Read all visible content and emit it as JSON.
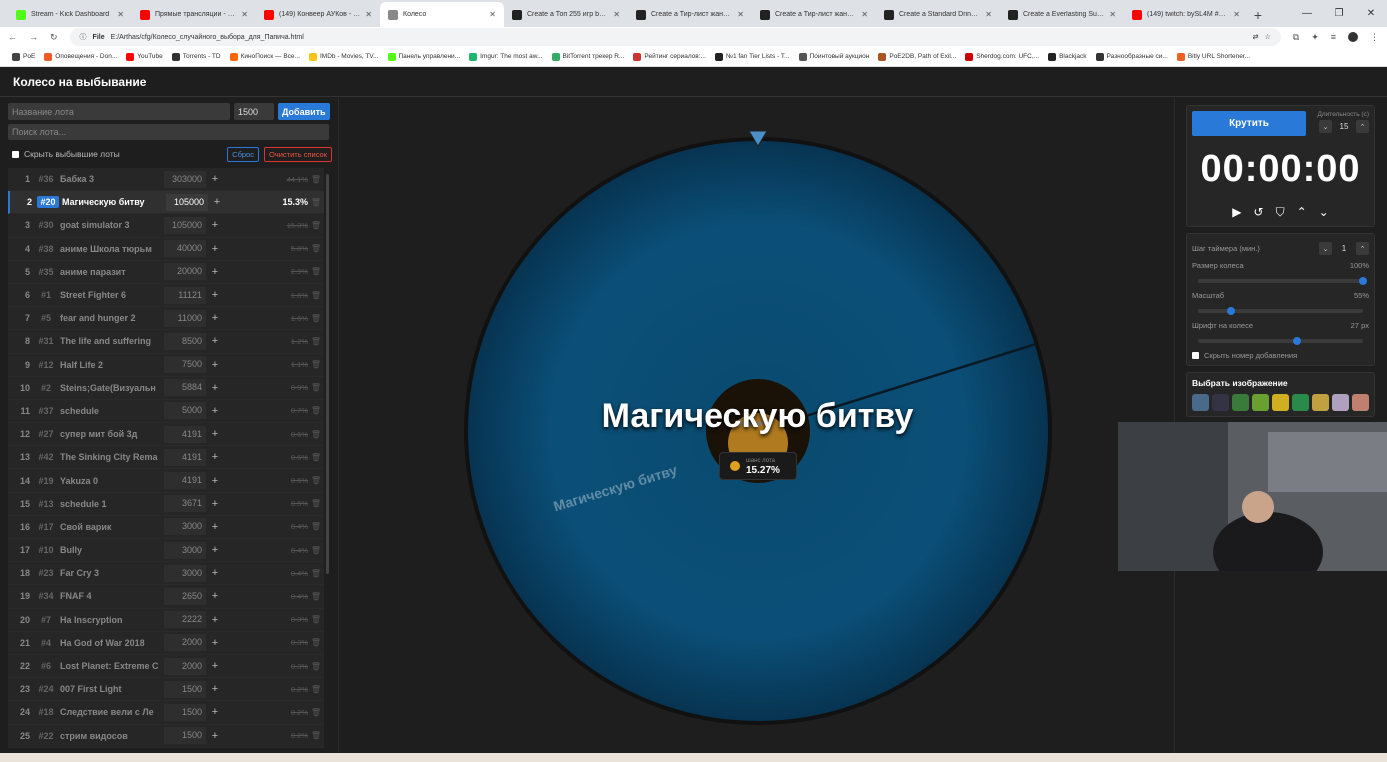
{
  "browser": {
    "tabs": [
      {
        "title": "Stream - Kick Dashboard",
        "color": "#53fc18",
        "active": false
      },
      {
        "title": "Прямые трансляции - YouTube",
        "color": "#ff0000",
        "active": false
      },
      {
        "title": "(149) Конвеер АУКов - YouTube",
        "color": "#ff0000",
        "active": false
      },
      {
        "title": "Колесо",
        "color": "#888888",
        "active": true
      },
      {
        "title": "Create a Топ 255 игр by Arthas",
        "color": "#222222",
        "active": false
      },
      {
        "title": "Create a Тир-лист жанров и игр",
        "color": "#222222",
        "active": false
      },
      {
        "title": "Create a Тир-лист жанров и игр",
        "color": "#222222",
        "active": false
      },
      {
        "title": "Create a Standard Drink Tier List",
        "color": "#222222",
        "active": false
      },
      {
        "title": "Create a Everlasting Summer",
        "color": "#222222",
        "active": false
      },
      {
        "title": "(149) twitch: bySL4M #sl4m",
        "color": "#ff0000",
        "active": false
      }
    ],
    "address_prefix": "File",
    "address": "E:/Arthas/cfg/Колесо_случайного_выбора_для_Папича.html",
    "bookmarks": [
      {
        "label": "PoE",
        "color": "#444"
      },
      {
        "label": "Оповещения - Don...",
        "color": "#f05a28"
      },
      {
        "label": "YouTube",
        "color": "#ff0000"
      },
      {
        "label": "Torrents - TD",
        "color": "#333"
      },
      {
        "label": "КиноПоиск — Все...",
        "color": "#f60"
      },
      {
        "label": "IMDb - Movies, TV...",
        "color": "#f5c518"
      },
      {
        "label": "Панель управлени...",
        "color": "#53fc18"
      },
      {
        "label": "Imgur: The most aw...",
        "color": "#1bb76e"
      },
      {
        "label": "BitTorrent трекер R...",
        "color": "#3a6"
      },
      {
        "label": "Рейтинг сериалов:...",
        "color": "#c33"
      },
      {
        "label": "№1 fan Tier Lists - T...",
        "color": "#222"
      },
      {
        "label": "Поинтовый аукцион",
        "color": "#555"
      },
      {
        "label": "PoE2DB, Path of Exil...",
        "color": "#a52"
      },
      {
        "label": "Sherdog.com: UFC,...",
        "color": "#c00"
      },
      {
        "label": "Blackjack",
        "color": "#222"
      },
      {
        "label": "Разнообразные си...",
        "color": "#333"
      },
      {
        "label": "Bitly URL Shortener...",
        "color": "#ee6123"
      }
    ]
  },
  "app": {
    "title": "Колесо на выбывание",
    "lot_name_placeholder": "Название лота",
    "amount_value": "1500",
    "add_label": "Добавить",
    "search_placeholder": "Поиск лота...",
    "hide_eliminated_label": "Скрыть выбывшие лоты",
    "reset_label": "Сброс",
    "clear_label": "Очистить список"
  },
  "lots": [
    {
      "n": "1",
      "id": "#36",
      "name": "Бабка 3",
      "amount": "303000",
      "pct": "44.1%",
      "selected": false
    },
    {
      "n": "2",
      "id": "#20",
      "name": "Магическую битву",
      "amount": "105000",
      "pct": "15.3%",
      "selected": true
    },
    {
      "n": "3",
      "id": "#30",
      "name": "goat simulator 3",
      "amount": "105000",
      "pct": "15.3%",
      "selected": false
    },
    {
      "n": "4",
      "id": "#38",
      "name": "аниме Школа тюрьм",
      "amount": "40000",
      "pct": "5.8%",
      "selected": false
    },
    {
      "n": "5",
      "id": "#35",
      "name": "аниме паразит",
      "amount": "20000",
      "pct": "2.9%",
      "selected": false
    },
    {
      "n": "6",
      "id": "#1",
      "name": "Street Fighter 6",
      "amount": "11121",
      "pct": "1.6%",
      "selected": false
    },
    {
      "n": "7",
      "id": "#5",
      "name": "fear and hunger 2",
      "amount": "11000",
      "pct": "1.6%",
      "selected": false
    },
    {
      "n": "8",
      "id": "#31",
      "name": "The life and suffering",
      "amount": "8500",
      "pct": "1.2%",
      "selected": false
    },
    {
      "n": "9",
      "id": "#12",
      "name": "Half Life 2",
      "amount": "7500",
      "pct": "1.1%",
      "selected": false
    },
    {
      "n": "10",
      "id": "#2",
      "name": "Steins;Gate(Визуальн",
      "amount": "5884",
      "pct": "0.9%",
      "selected": false
    },
    {
      "n": "11",
      "id": "#37",
      "name": "schedule",
      "amount": "5000",
      "pct": "0.7%",
      "selected": false
    },
    {
      "n": "12",
      "id": "#27",
      "name": "супер мит бой 3д",
      "amount": "4191",
      "pct": "0.6%",
      "selected": false
    },
    {
      "n": "13",
      "id": "#42",
      "name": "The Sinking City Rema",
      "amount": "4191",
      "pct": "0.6%",
      "selected": false
    },
    {
      "n": "14",
      "id": "#19",
      "name": "Yakuza 0",
      "amount": "4191",
      "pct": "0.6%",
      "selected": false
    },
    {
      "n": "15",
      "id": "#13",
      "name": "schedule 1",
      "amount": "3671",
      "pct": "0.5%",
      "selected": false
    },
    {
      "n": "16",
      "id": "#17",
      "name": "Свой варик",
      "amount": "3000",
      "pct": "0.4%",
      "selected": false
    },
    {
      "n": "17",
      "id": "#10",
      "name": "Bully",
      "amount": "3000",
      "pct": "0.4%",
      "selected": false
    },
    {
      "n": "18",
      "id": "#23",
      "name": "Far Cry 3",
      "amount": "3000",
      "pct": "0.4%",
      "selected": false
    },
    {
      "n": "19",
      "id": "#34",
      "name": "FNAF 4",
      "amount": "2650",
      "pct": "0.4%",
      "selected": false
    },
    {
      "n": "20",
      "id": "#7",
      "name": "На Inscryption",
      "amount": "2222",
      "pct": "0.3%",
      "selected": false
    },
    {
      "n": "21",
      "id": "#4",
      "name": "На God of War 2018",
      "amount": "2000",
      "pct": "0.3%",
      "selected": false
    },
    {
      "n": "22",
      "id": "#6",
      "name": "Lost Planet: Extreme C",
      "amount": "2000",
      "pct": "0.3%",
      "selected": false
    },
    {
      "n": "23",
      "id": "#24",
      "name": "007 First Light",
      "amount": "1500",
      "pct": "0.2%",
      "selected": false
    },
    {
      "n": "24",
      "id": "#18",
      "name": "Следствие вели с Ле",
      "amount": "1500",
      "pct": "0.2%",
      "selected": false
    },
    {
      "n": "25",
      "id": "#22",
      "name": "стрим видосов",
      "amount": "1500",
      "pct": "0.2%",
      "selected": false
    }
  ],
  "wheel": {
    "winner_label": "Магическую битву",
    "previous_label": "Бабка 3",
    "segment_label": "Магическую битву",
    "chance_caption": "шанс лота",
    "chance_value": "15.27%"
  },
  "right_panel": {
    "spin_label": "Крутить",
    "duration_label": "Длительность (с)",
    "duration_value": "15",
    "timer": "00:00:00",
    "timer_step_label": "Шаг таймера (мин.)",
    "timer_step_value": "1",
    "wheel_size_label": "Размер колеса",
    "wheel_size_value": "100%",
    "wheel_size_fraction": 1.0,
    "scale_label": "Масштаб",
    "scale_value": "55%",
    "scale_fraction": 0.2,
    "font_label": "Шрифт на колесе",
    "font_value": "27 px",
    "font_fraction": 0.6,
    "hide_number_label": "Скрыть номер добавления",
    "image_title": "Выбрать изображение",
    "image_swatches": [
      "#4a6a8a",
      "#333344",
      "#3a7a3a",
      "#6aa030",
      "#d0b020",
      "#2a8a4a",
      "#c0a040",
      "#b0a0c0",
      "#c08070"
    ]
  }
}
